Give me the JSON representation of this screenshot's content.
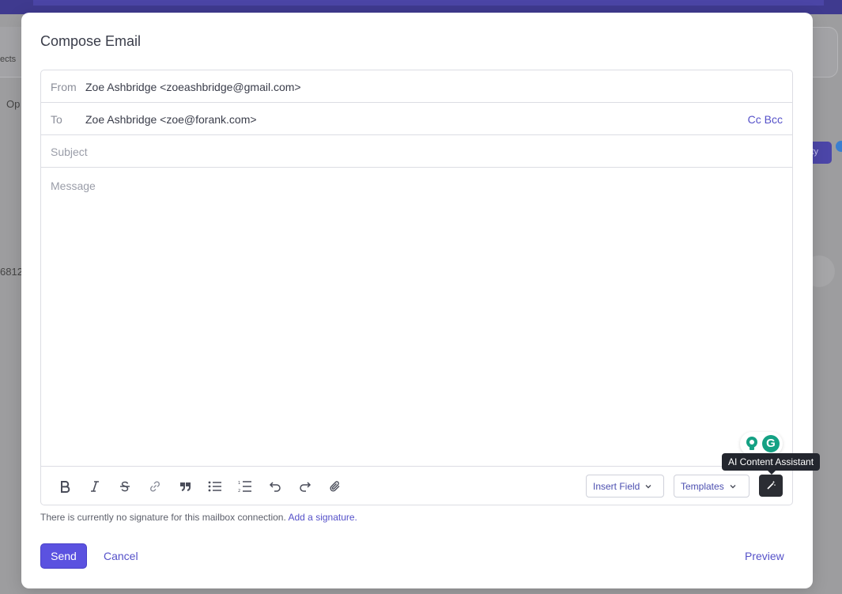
{
  "background": {
    "left_text_1": "ects",
    "left_text_2": "Op",
    "left_text_3": "6812",
    "right_pill": "ity"
  },
  "modal": {
    "title": "Compose Email",
    "from": {
      "label": "From",
      "value": "Zoe Ashbridge <zoeashbridge@gmail.com>"
    },
    "to": {
      "label": "To",
      "value": "Zoe Ashbridge <zoe@forank.com>",
      "cc": "Cc",
      "bcc": "Bcc"
    },
    "subject": {
      "placeholder": "Subject"
    },
    "message": {
      "placeholder": "Message"
    },
    "toolbar": {
      "icons": [
        "bold-icon",
        "italic-icon",
        "strikethrough-icon",
        "link-icon",
        "quote-icon",
        "bullet-list-icon",
        "numbered-list-icon",
        "undo-icon",
        "redo-icon",
        "attachment-icon"
      ],
      "insert_field": "Insert Field",
      "templates": "Templates",
      "ai_tooltip": "AI Content Assistant"
    },
    "signature": {
      "note": "There is currently no signature for this mailbox connection.",
      "link": "Add a signature."
    },
    "actions": {
      "send": "Send",
      "cancel": "Cancel",
      "preview": "Preview"
    }
  },
  "colors": {
    "accent": "#5b52e0",
    "link": "#5551c9",
    "grammarly": "#15a184"
  }
}
